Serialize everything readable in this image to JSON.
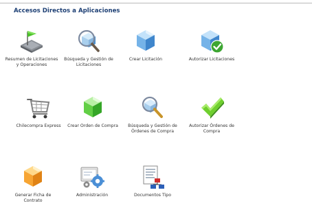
{
  "section": {
    "title": "Accesos Directos a Aplicaciones"
  },
  "shortcuts": [
    {
      "icon": "flag-map-icon",
      "label_lines": [
        "Resumen de Licitaciones",
        "y Operaciones"
      ]
    },
    {
      "icon": "magnifier-cube-icon",
      "label_lines": [
        "Búsqueda y Gestión de",
        "Licitaciones"
      ]
    },
    {
      "icon": "blue-cube-icon",
      "label_lines": [
        "Crear Licitación"
      ]
    },
    {
      "icon": "cube-checkmark-icon",
      "label_lines": [
        "Autorizar Licitaciones"
      ]
    },
    {
      "icon": "shopping-cart-icon",
      "label_lines": [
        "Chilecompra Express"
      ]
    },
    {
      "icon": "green-cube-icon",
      "label_lines": [
        "Crear Orden de Compra"
      ]
    },
    {
      "icon": "magnifier-green-icon",
      "label_lines": [
        "Búsqueda y Gestión de",
        "Órdenes de Compra"
      ]
    },
    {
      "icon": "green-checkmark-icon",
      "label_lines": [
        "Autorizar Órdenes de",
        "Compra"
      ]
    },
    {
      "icon": "orange-cube-icon",
      "label_lines": [
        "Generar Ficha de",
        "Contrato"
      ]
    },
    {
      "icon": "admin-gears-icon",
      "label_lines": [
        "Administración"
      ]
    },
    {
      "icon": "document-templates-icon",
      "label_lines": [
        "Documentos Tipo"
      ]
    }
  ],
  "colors": {
    "title": "#1d3f74",
    "label": "#333333",
    "rule": "#b8b8b8"
  }
}
